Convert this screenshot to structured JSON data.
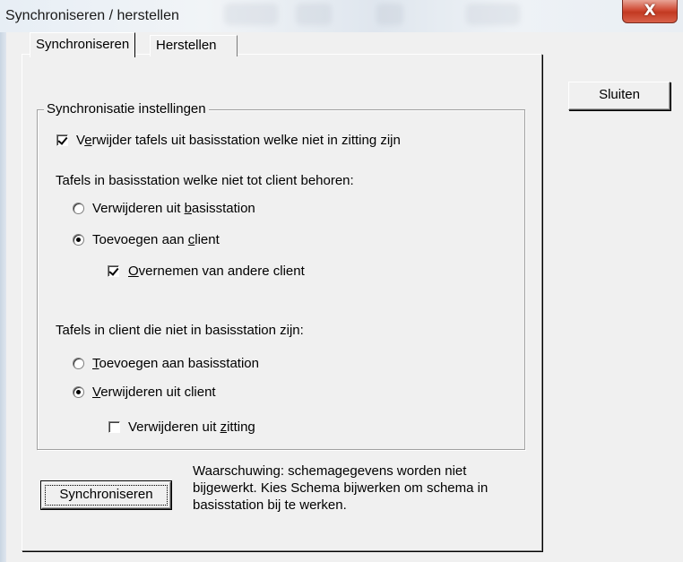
{
  "window": {
    "title": "Synchroniseren / herstellen",
    "close_glyph": "X"
  },
  "tabs": [
    {
      "label": "Synchroniseren",
      "active": true
    },
    {
      "label": "Herstellen",
      "active": false
    }
  ],
  "group": {
    "title": "Synchronisatie instellingen",
    "remove_tables": {
      "pre": "V",
      "key": "e",
      "post": "rwijder tafels uit basisstation welke niet in zitting zijn",
      "checked": true
    },
    "section1_label": "Tafels in basisstation welke niet tot client behoren:",
    "radio_remove_base": {
      "pre": "Verwijderen uit ",
      "key": "b",
      "post": "asisstation",
      "checked": false
    },
    "radio_add_client": {
      "pre": "Toevoegen aan ",
      "key": "c",
      "post": "lient",
      "checked": true
    },
    "take_over": {
      "pre": "",
      "key": "O",
      "post": "vernemen van andere client",
      "checked": true
    },
    "section2_label": "Tafels in client die niet in basisstation zijn:",
    "radio_add_base": {
      "pre": "",
      "key": "T",
      "post": "oevoegen aan basisstation",
      "checked": false
    },
    "radio_remove_client": {
      "pre": "",
      "key": "V",
      "post": "erwijderen uit client",
      "checked": true
    },
    "remove_session": {
      "pre": "Verwijderen uit ",
      "key": "z",
      "post": "itting",
      "checked": false
    }
  },
  "buttons": {
    "close": "Sluiten",
    "sync": "Synchroniseren"
  },
  "warning": {
    "line1": "Waarschuwing: schemagegevens worden niet",
    "line2": "bijgewerkt. Kies Schema bijwerken om schema in",
    "line3": "basisstation bij te werken."
  }
}
